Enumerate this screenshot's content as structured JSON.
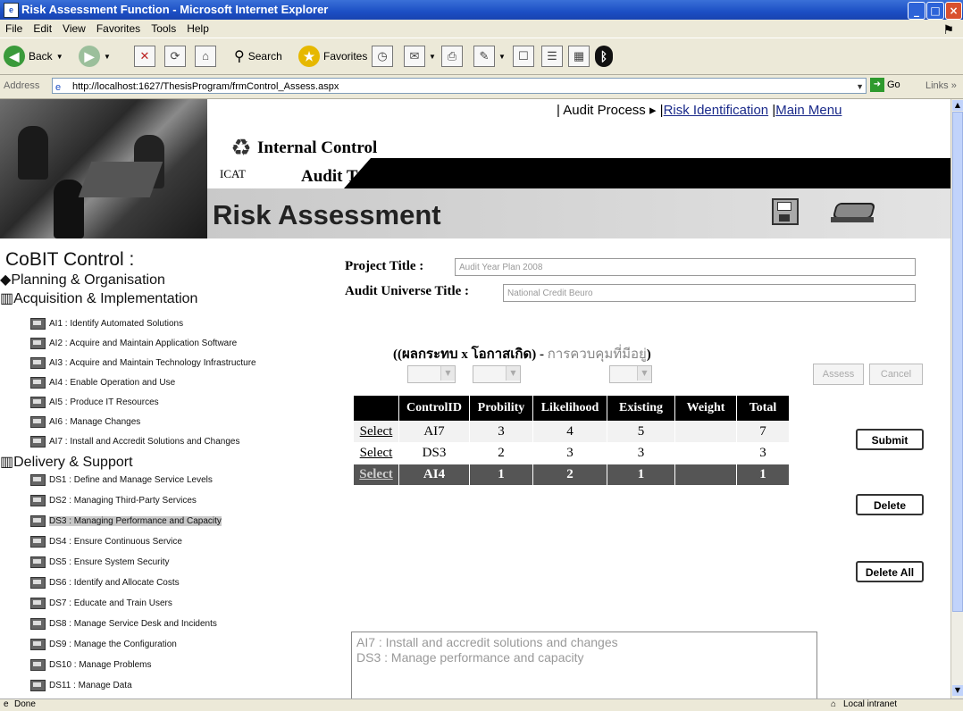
{
  "window": {
    "title": "Risk Assessment Function - Microsoft Internet Explorer"
  },
  "menu": [
    "File",
    "Edit",
    "View",
    "Favorites",
    "Tools",
    "Help"
  ],
  "toolbar": {
    "back": "Back",
    "search": "Search",
    "favorites": "Favorites"
  },
  "address": {
    "label": "Address",
    "url": "http://localhost:1627/ThesisProgram/frmControl_Assess.aspx",
    "go": "Go",
    "links": "Links"
  },
  "header": {
    "brand_line1": "Internal  Control",
    "brand_line2": "Audit  Tool",
    "brand_abbr": "ICAT",
    "page_title": "Risk Assessment",
    "nav": {
      "sep1": "|",
      "audit_process": "Audit Process",
      "arrow": "▸",
      "sep2": "|",
      "risk_identification": "Risk Identification",
      "sep3": "|",
      "main_menu": "Main Menu"
    }
  },
  "tree": {
    "title": "CoBIT Control :",
    "domains": [
      {
        "label": "Planning & Organisation"
      },
      {
        "label": "Acquisition & Implementation"
      },
      {
        "label": "Delivery & Support"
      }
    ],
    "ai_items": [
      "AI1 : Identify Automated Solutions",
      "AI2 : Acquire and Maintain Application Software",
      "AI3 : Acquire and Maintain Technology Infrastructure",
      "AI4 : Enable Operation and Use",
      "AI5 : Produce IT Resources",
      "AI6 : Manage Changes",
      "AI7 : Install and Accredit Solutions and Changes"
    ],
    "ds_items": [
      "DS1 : Define and Manage Service Levels",
      "DS2 : Managing Third-Party Services",
      "DS3 : Managing Performance and Capacity",
      "DS4 : Ensure Continuous Service",
      "DS5 : Ensure System Security",
      "DS6 : Identify and Allocate Costs",
      "DS7 : Educate and Train Users",
      "DS8 : Manage Service Desk and Incidents",
      "DS9 : Manage the Configuration",
      "DS10 : Manage Problems",
      "DS11 : Manage Data"
    ],
    "selected_item": "DS3 : Managing Performance and Capacity"
  },
  "form": {
    "project_title_label": "Project Title :",
    "project_title_value": "Audit Year Plan 2008",
    "universe_title_label": "Audit Universe Title :",
    "universe_title_value": "National Credit Beuro",
    "formula_open": "((ผลกระทบ x โอกาสเกิด) -",
    "formula_grey": "การควบคุมที่มีอยู่",
    "formula_close": ")",
    "assess_label": "Assess",
    "cancel_label": "Cancel"
  },
  "table": {
    "columns": [
      "",
      "ControlID",
      "Probility",
      "Likelihood",
      "Existing",
      "Weight",
      "Total"
    ],
    "rows": [
      {
        "select": "Select",
        "control_id": "AI7",
        "probility": "3",
        "likelihood": "4",
        "existing": "5",
        "weight": "",
        "total": "7"
      },
      {
        "select": "Select",
        "control_id": "DS3",
        "probility": "2",
        "likelihood": "3",
        "existing": "3",
        "weight": "",
        "total": "3"
      },
      {
        "select": "Select",
        "control_id": "AI4",
        "probility": "1",
        "likelihood": "2",
        "existing": "1",
        "weight": "",
        "total": "1"
      }
    ]
  },
  "actions": {
    "submit": "Submit",
    "delete": "Delete",
    "delete_all": "Delete All"
  },
  "description": [
    "AI7 : Install and accredit solutions and changes",
    "DS3 : Manage performance and capacity"
  ],
  "status": {
    "left": "Done",
    "zone": "Local intranet"
  }
}
